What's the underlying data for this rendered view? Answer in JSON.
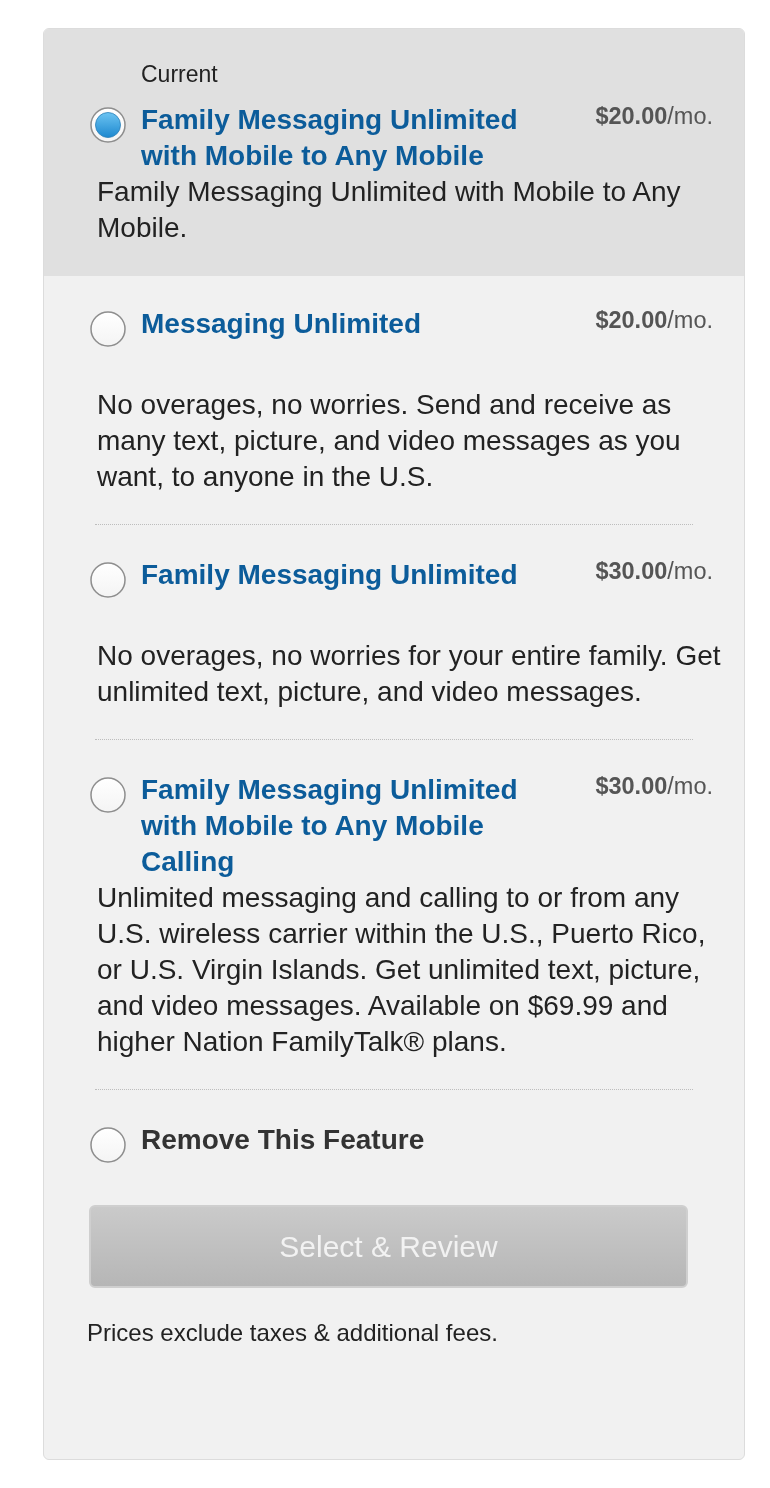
{
  "current_plan": {
    "label": "Current",
    "selected": true,
    "title": "Family Messaging Unlimited with Mobile to Any Mobile",
    "price": "**$20.00**/mo.",
    "description": "Family Messaging Unlimited with Mobile to Any Mobile."
  },
  "other_options": [
    {
      "kind": "plan",
      "selected": false,
      "title": "Messaging Unlimited",
      "price": "**$20.00**/mo.",
      "description": "No overages, no worries. Send and receive as many text, picture, and video messages as you want, to anyone in the U.S."
    },
    {
      "kind": "plan",
      "selected": false,
      "title": "Family Messaging Unlimited",
      "price": "**$30.00**/mo.",
      "description": "No overages, no worries for your entire family. Get unlimited text, picture, and video messages."
    },
    {
      "kind": "plan",
      "selected": false,
      "title": "Family Messaging Unlimited with Mobile to Any Mobile Calling",
      "price": "**$30.00**/mo.",
      "description": "Unlimited messaging and calling to or from any U.S. wireless carrier within the U.S., Puerto Rico, or U.S. Virgin Islands. Get unlimited text, picture, and video messages. Available on $69.99 and higher Nation FamilyTalk® plans."
    },
    {
      "kind": "remove",
      "selected": false,
      "title": "Remove This Feature"
    }
  ],
  "button": {
    "label": "Select & Review",
    "disabled": true
  },
  "footnote": "Prices exclude taxes & additional fees."
}
